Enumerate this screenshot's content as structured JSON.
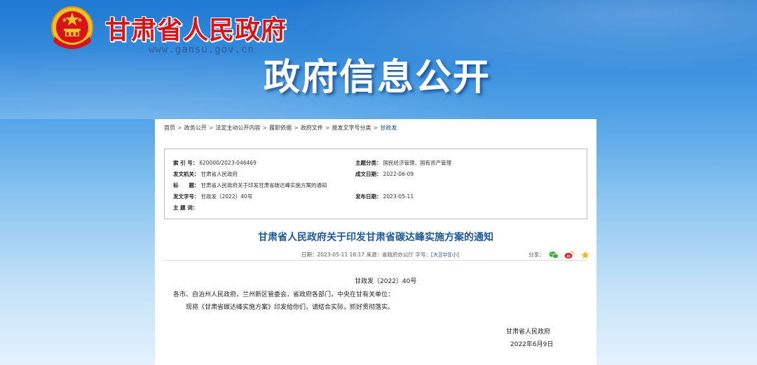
{
  "header": {
    "gov_name": "甘肃省人民政府",
    "site_url": "www.gansu.gov.cn",
    "section_title": "政府信息公开"
  },
  "breadcrumb": {
    "items": [
      "首页",
      "政务公开",
      "法定主动公开内容",
      "履职依据",
      "政府文件",
      "按发文字号分类",
      "甘政发"
    ],
    "separator": ">"
  },
  "meta": {
    "index_label": "索 引 号：",
    "index_value": "620000/2023-046469",
    "category_label": "主题分类：",
    "category_value": "国民经济管理、国有资产管理",
    "issuer_label": "发文机关：",
    "issuer_value": "甘肃省人民政府",
    "created_label": "成文日期：",
    "created_value": "2022-06-09",
    "title_label": "标　　题：",
    "title_value": "甘肃省人民政府关于印发甘肃省碳达峰实施方案的通知",
    "docno_label": "发文字号：",
    "docno_value": "甘政发〔2022〕40号",
    "published_label": "发布日期：",
    "published_value": "2023-05-11",
    "keywords_label": "主 题 词：",
    "keywords_value": ""
  },
  "document": {
    "title": "甘肃省人民政府关于印发甘肃省碳达峰实施方案的通知",
    "date_line": "日期：2023-05-11 16:17 来源：省政府办公厅   字号：",
    "font_large": "[大]",
    "font_mid": "[中]",
    "font_small": "[小]",
    "share_label": "分享：",
    "doc_number": "甘政发〔2022〕40号",
    "recipients": "各市、自治州人民政府，兰州新区管委会，省政府各部门，中央在甘有关单位：",
    "body": "现将《甘肃省碳达峰实施方案》印发给你们，请结合实际，抓好贯彻落实。",
    "signature": "甘肃省人民政府",
    "sign_date": "2022年6月9日"
  },
  "icons": {
    "emblem": "national-emblem",
    "wechat": "wechat-icon",
    "weibo": "weibo-icon",
    "favorite": "star-icon"
  },
  "colors": {
    "gov_red": "#d8141b",
    "link_blue": "#1d5a9c",
    "wechat_green": "#3cb034",
    "weibo_red": "#e6162d",
    "star_yellow": "#f5b400"
  }
}
